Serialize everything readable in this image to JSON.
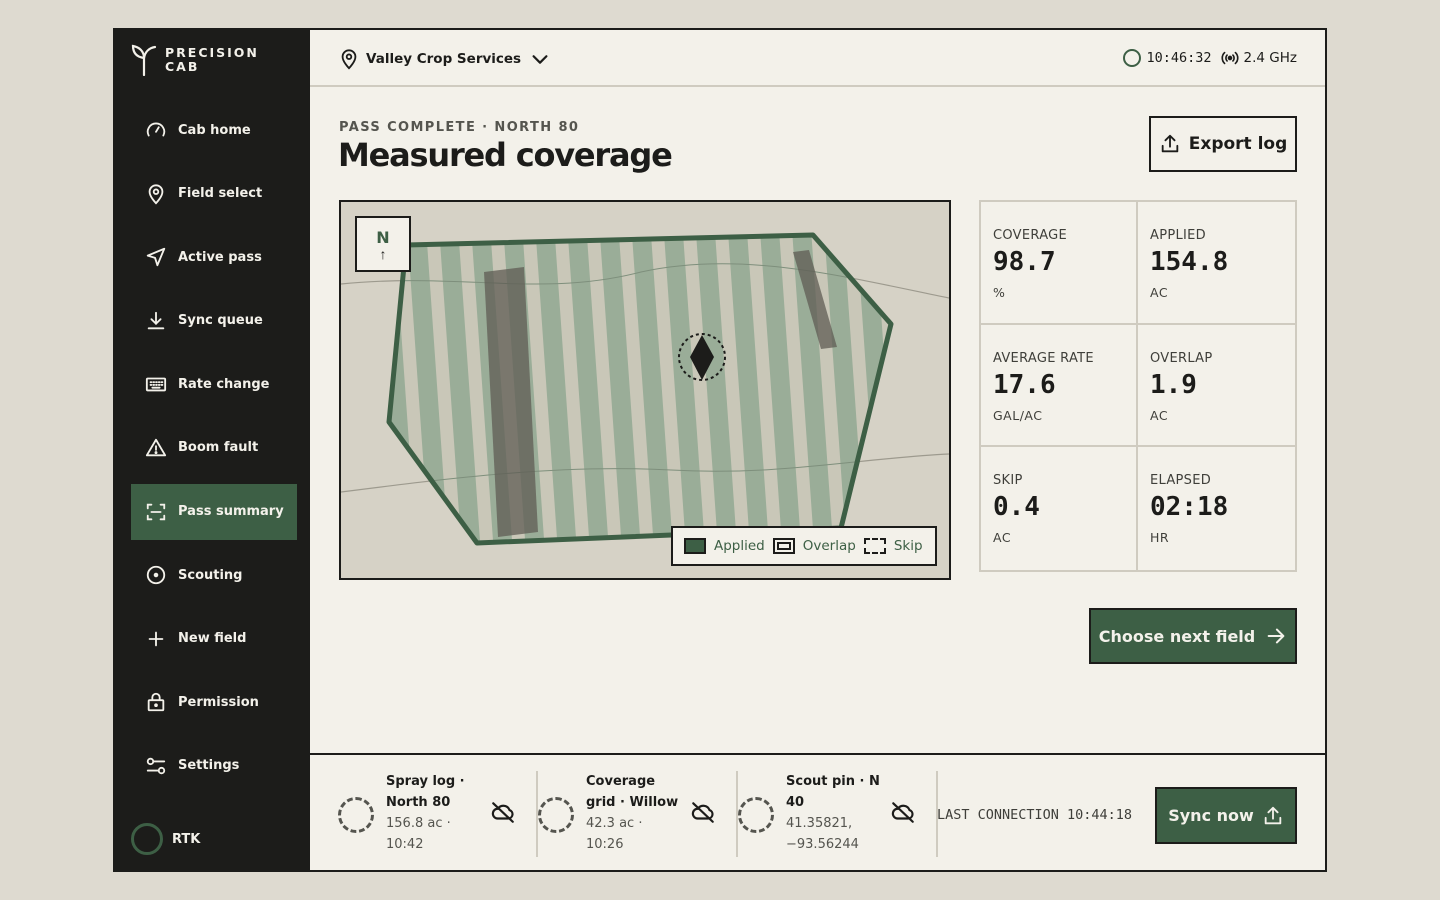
{
  "brand": {
    "name": "PRECISION\nCAB",
    "icon": "sprout-icon"
  },
  "colors": {
    "accent": "#3d5f45",
    "ink": "#1c1c1a",
    "paper": "#f3f1ea",
    "frame": "#dedad0"
  },
  "sidebar": {
    "items": [
      {
        "label": "Cab home",
        "icon": "gauge-icon"
      },
      {
        "label": "Field select",
        "icon": "map-pin-icon"
      },
      {
        "label": "Active pass",
        "icon": "navigation-icon"
      },
      {
        "label": "Sync queue",
        "icon": "download-icon"
      },
      {
        "label": "Rate change",
        "icon": "keyboard-icon"
      },
      {
        "label": "Boom fault",
        "icon": "warning-icon"
      },
      {
        "label": "Pass summary",
        "icon": "scan-icon",
        "active": true
      },
      {
        "label": "Scouting",
        "icon": "target-icon"
      },
      {
        "label": "New field",
        "icon": "plus-icon"
      },
      {
        "label": "Permission",
        "icon": "lock-icon"
      },
      {
        "label": "Settings",
        "icon": "sliders-icon"
      }
    ],
    "rtk_label": "RTK"
  },
  "topbar": {
    "org_name": "Valley Crop Services",
    "time": "10:46:32",
    "signal": "2.4 GHz"
  },
  "main": {
    "eyebrow": "PASS COMPLETE · NORTH 80",
    "title": "Measured coverage",
    "export_label": "Export log",
    "next_label": "Choose next field"
  },
  "map": {
    "north": "N",
    "north_arrow": "↑",
    "legend": {
      "applied": "Applied",
      "overlap": "Overlap",
      "skip": "Skip"
    }
  },
  "stats": [
    {
      "label": "COVERAGE",
      "value": "98.7",
      "unit": "%"
    },
    {
      "label": "APPLIED",
      "value": "154.8",
      "unit": "AC"
    },
    {
      "label": "AVERAGE RATE",
      "value": "17.6",
      "unit": "GAL/AC"
    },
    {
      "label": "OVERLAP",
      "value": "1.9",
      "unit": "AC"
    },
    {
      "label": "SKIP",
      "value": "0.4",
      "unit": "AC"
    },
    {
      "label": "ELAPSED",
      "value": "02:18",
      "unit": "HR"
    }
  ],
  "sync": {
    "queue": [
      {
        "title": "Spray log · North 80",
        "meta": "156.8 ac · 10:42"
      },
      {
        "title": "Coverage grid · Willow",
        "meta": "42.3 ac · 10:26"
      },
      {
        "title": "Scout pin · N 40",
        "meta": "41.35821, −93.56244"
      }
    ],
    "last_connection": "LAST CONNECTION 10:44:18",
    "sync_label": "Sync now"
  }
}
